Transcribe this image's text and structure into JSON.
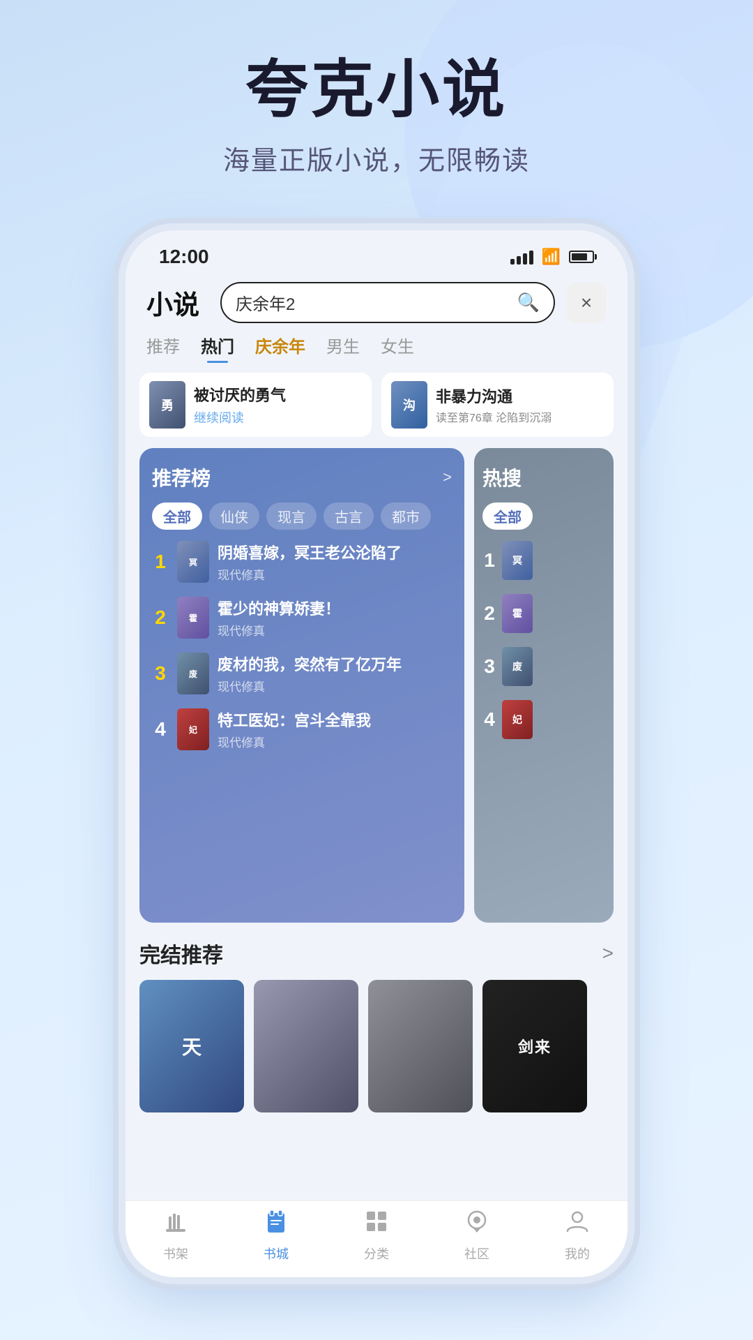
{
  "hero": {
    "title": "夸克小说",
    "subtitle": "海量正版小说，无限畅读"
  },
  "statusBar": {
    "time": "12:00"
  },
  "header": {
    "appTitle": "小说",
    "searchPlaceholder": "庆余年2",
    "closeBtn": "×"
  },
  "navTabs": [
    {
      "label": "推荐",
      "id": "recommend",
      "active": false,
      "special": false
    },
    {
      "label": "热门",
      "id": "hot",
      "active": true,
      "special": false
    },
    {
      "label": "庆余年",
      "id": "qingyunian",
      "active": false,
      "special": true
    },
    {
      "label": "男生",
      "id": "male",
      "active": false,
      "special": false
    },
    {
      "label": "女生",
      "id": "female",
      "active": false,
      "special": false
    }
  ],
  "recentReads": [
    {
      "title": "被讨厌的勇气",
      "action": "继续阅读",
      "coverBg": "#7080a0",
      "coverText": "勇"
    },
    {
      "title": "非暴力沟通",
      "progress": "读至第76章 沦陷到沉溺",
      "coverBg": "#5090b0",
      "coverText": "沟"
    }
  ],
  "rankingPanel": {
    "title": "推荐榜",
    "arrowLabel": ">",
    "filters": [
      "全部",
      "仙侠",
      "现言",
      "古言",
      "都市"
    ],
    "activeFilter": "全部",
    "items": [
      {
        "rank": 1,
        "title": "阴婚喜嫁，冥王老公沦陷了",
        "genre": "现代修真",
        "coverBg": "linear-gradient(135deg, #8090b8, #4060a0)",
        "coverText": "冥"
      },
      {
        "rank": 2,
        "title": "霍少的神算娇妻！",
        "genre": "现代修真",
        "coverBg": "linear-gradient(135deg, #9080c0, #6050a0)",
        "coverText": "霍"
      },
      {
        "rank": 3,
        "title": "废材的我，突然有了亿万年",
        "genre": "现代修真",
        "coverBg": "linear-gradient(135deg, #7090a8, #405070)",
        "coverText": "废"
      },
      {
        "rank": 4,
        "title": "特工医妃：宫斗全靠我",
        "genre": "现代修真",
        "coverBg": "linear-gradient(135deg, #c04040, #802020)",
        "coverText": "妃"
      }
    ]
  },
  "hotSearchPanel": {
    "title": "热搜",
    "filters": [
      "全部"
    ],
    "items": [
      {
        "rank": 1,
        "coverBg": "linear-gradient(135deg, #8090b8, #4060a0)",
        "coverText": "冥"
      },
      {
        "rank": 2,
        "coverBg": "linear-gradient(135deg, #9080c0, #6050a0)",
        "coverText": "霍"
      },
      {
        "rank": 3,
        "coverBg": "linear-gradient(135deg, #7090a8, #405070)",
        "coverText": "废"
      },
      {
        "rank": 4,
        "coverBg": "linear-gradient(135deg, #c04040, #802020)",
        "coverText": "妃"
      }
    ]
  },
  "completedSection": {
    "title": "完结推荐",
    "arrowLabel": ">",
    "books": [
      {
        "coverBg": "linear-gradient(135deg, #6090c0, #304880)",
        "text": "天"
      },
      {
        "coverBg": "linear-gradient(135deg, #9898b0, #505068)",
        "text": ""
      },
      {
        "coverBg": "linear-gradient(135deg, #808090, #404050)",
        "text": ""
      },
      {
        "coverBg": "linear-gradient(135deg, #222222, #111111)",
        "text": "剑来",
        "textSize": "22px"
      }
    ]
  },
  "bottomNav": [
    {
      "label": "书架",
      "icon": "📚",
      "active": false,
      "id": "shelf"
    },
    {
      "label": "书城",
      "icon": "📖",
      "active": true,
      "id": "store"
    },
    {
      "label": "分类",
      "icon": "⠿",
      "active": false,
      "id": "category"
    },
    {
      "label": "社区",
      "icon": "💬",
      "active": false,
      "id": "community"
    },
    {
      "label": "我的",
      "icon": "👤",
      "active": false,
      "id": "profile"
    }
  ]
}
